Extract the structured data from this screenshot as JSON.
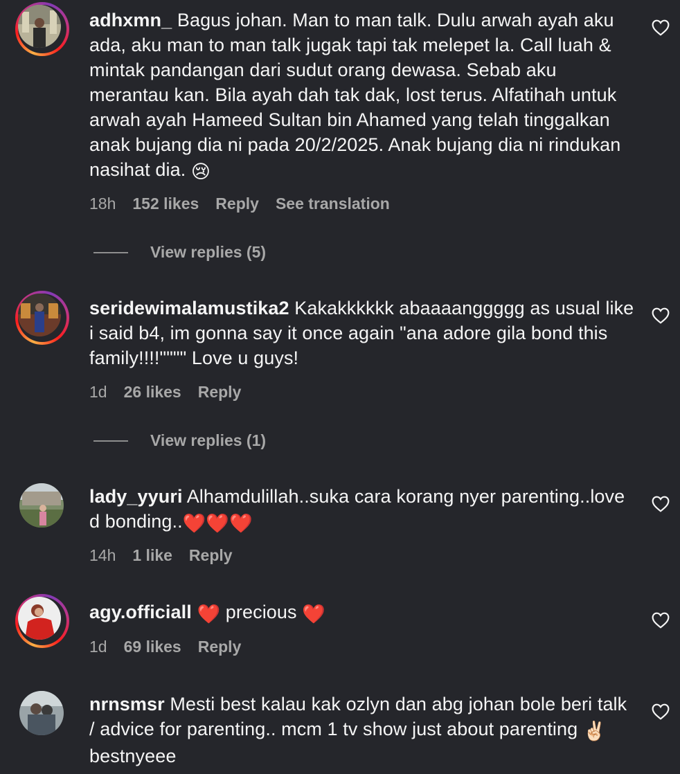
{
  "comments": [
    {
      "username": "adhxmn_",
      "text": "Bagus johan. Man to man talk. Dulu arwah ayah aku ada, aku man to man talk jugak tapi tak melepet la. Call luah & mintak pandangan dari sudut orang dewasa. Sebab aku merantau kan. Bila ayah dah tak dak, lost terus. Alfatihah untuk arwah ayah Hameed Sultan bin Ahamed yang telah tinggalkan anak bujang dia ni pada 20/2/2025. Anak bujang dia ni rindukan nasihat dia.",
      "emoji": "😢",
      "time": "18h",
      "likes": "152 likes",
      "reply": "Reply",
      "translate": "See translation",
      "view_replies": "View replies (5)"
    },
    {
      "username": "seridewimalamustika2",
      "text": "Kakakkkkkk abaaaanggggg as usual like i said b4, im gonna say it once again \"ana adore gila bond this family!!!!\"\"\"\" Love u guys!",
      "time": "1d",
      "likes": "26 likes",
      "reply": "Reply",
      "view_replies": "View replies (1)"
    },
    {
      "username": "lady_yyuri",
      "text": "Alhamdulillah..suka cara korang nyer parenting..love d bonding..",
      "emoji": "❤️❤️❤️",
      "time": "14h",
      "likes": "1 like",
      "reply": "Reply"
    },
    {
      "username": "agy.officiall",
      "text_a": "❤️",
      "text_b": "precious",
      "text_c": "❤️",
      "time": "1d",
      "likes": "69 likes",
      "reply": "Reply"
    },
    {
      "username": "nrnsmsr",
      "text": "Mesti best kalau kak ozlyn dan abg johan bole beri talk / advice for parenting.. mcm 1 tv show just about parenting",
      "emoji": "✌🏻",
      "text_after": "bestnyeee"
    }
  ],
  "icons": {
    "like": "heart-outline-icon"
  },
  "colors": {
    "background": "#25262b",
    "text": "#f5f5f5",
    "muted": "#a8a8a8",
    "heart": "#e0245e"
  }
}
